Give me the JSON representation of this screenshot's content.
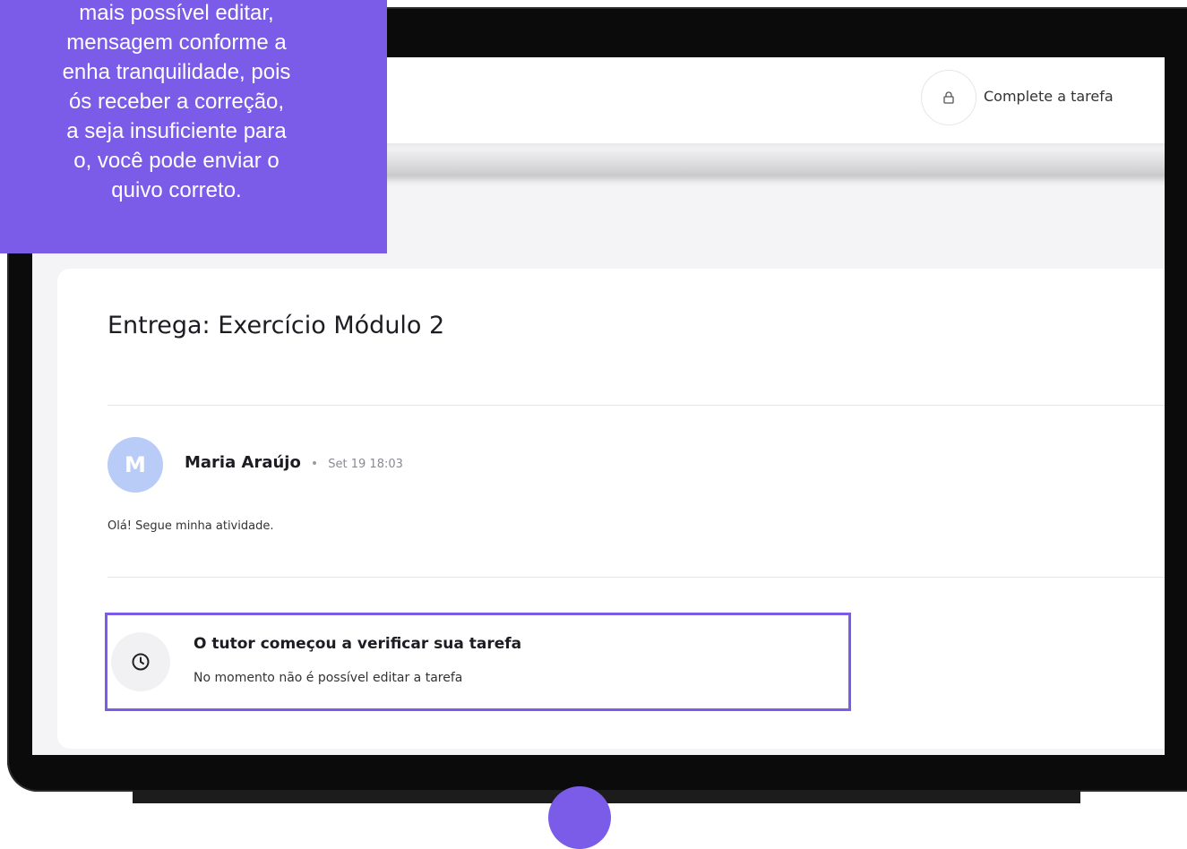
{
  "tooltip": {
    "lines": [
      "mais possível editar,",
      "mensagem conforme a",
      "enha tranquilidade, pois",
      "ós receber a correção,",
      "a seja insuficiente para",
      "o,  você pode enviar o",
      "quivo correto."
    ]
  },
  "header": {
    "complete_label": "Complete a tarefa",
    "lock_icon": "lock-icon"
  },
  "card": {
    "title": "Entrega: Exercício Módulo 2"
  },
  "post": {
    "avatar_initial": "M",
    "avatar_color": "#b9ccf7",
    "author": "Maria Araújo",
    "separator": "•",
    "timestamp": "Set 19 18:03",
    "message": "Olá! Segue minha atividade."
  },
  "status": {
    "icon": "clock-icon",
    "title": "O tutor começou a verificar sua tarefa",
    "subtitle": "No momento não é possível editar a tarefa",
    "highlight_color": "#7b5ce8"
  }
}
